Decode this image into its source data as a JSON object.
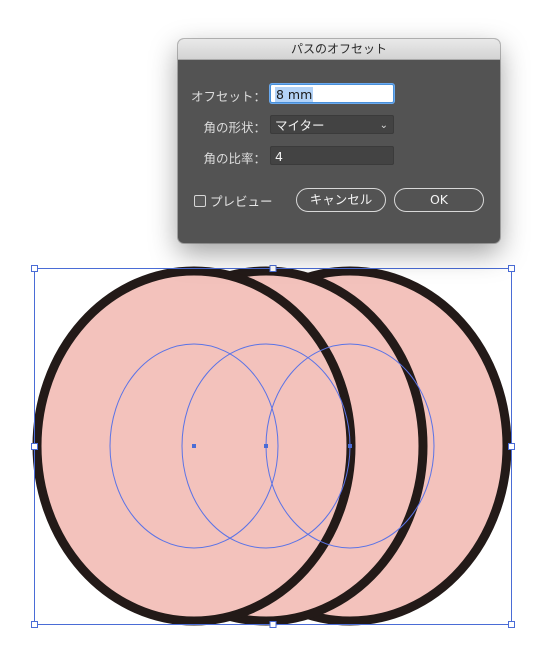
{
  "dialog": {
    "title": "パスのオフセット",
    "offset_label": "オフセット：",
    "offset_value": "8 mm",
    "joins_label": "角の形状：",
    "joins_value": "マイター",
    "miter_label": "角の比率：",
    "miter_value": "4",
    "preview_label": "プレビュー",
    "preview_checked": false,
    "cancel_label": "キャンセル",
    "ok_label": "OK"
  },
  "artwork": {
    "fill_color": "#f3c2bc",
    "stroke_color": "#231a18",
    "path_color": "#5b73e6",
    "selection_color": "#4a6cd6"
  }
}
